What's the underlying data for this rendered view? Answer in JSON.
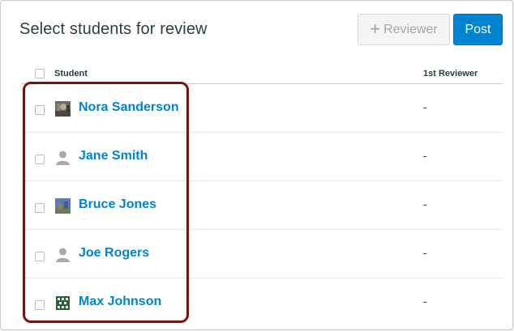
{
  "page": {
    "title": "Select students for review"
  },
  "toolbar": {
    "reviewer_label": "Reviewer",
    "reviewer_icon": "plus-icon",
    "post_label": "Post"
  },
  "table": {
    "headers": {
      "student": "Student",
      "first_reviewer": "1st Reviewer"
    },
    "rows": [
      {
        "name": "Nora Sanderson",
        "reviewer": "-",
        "avatar": "photo-avatar"
      },
      {
        "name": "Jane Smith",
        "reviewer": "-",
        "avatar": "default-user-avatar"
      },
      {
        "name": "Bruce Jones",
        "reviewer": "-",
        "avatar": "photo-avatar"
      },
      {
        "name": "Joe Rogers",
        "reviewer": "-",
        "avatar": "default-user-avatar"
      },
      {
        "name": "Max Johnson",
        "reviewer": "-",
        "avatar": "pattern-avatar"
      }
    ]
  },
  "colors": {
    "accent": "#0084d1",
    "highlight_border": "#7a1212",
    "text": "#2d3b45"
  }
}
